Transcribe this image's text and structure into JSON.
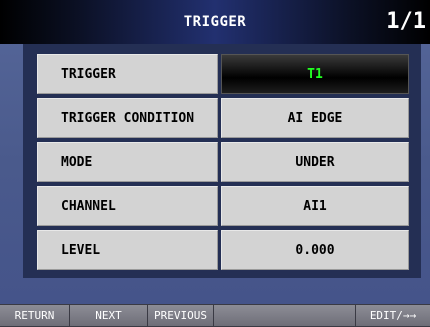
{
  "header": {
    "title": "TRIGGER",
    "page": "1/1"
  },
  "settings": [
    {
      "label": "TRIGGER",
      "value": "T1"
    },
    {
      "label": "TRIGGER CONDITION",
      "value": "AI EDGE"
    },
    {
      "label": "MODE",
      "value": "UNDER"
    },
    {
      "label": "CHANNEL",
      "value": "AI1"
    },
    {
      "label": "LEVEL",
      "value": "0.000"
    }
  ],
  "softkeys": [
    "RETURN",
    "NEXT",
    "PREVIOUS",
    "",
    "EDIT/→→"
  ],
  "colors": {
    "background": "#4a5a8c",
    "panel": "#242f54",
    "cell": "#d3d3d3",
    "active_value_text": "#22ff22",
    "softkey": "#7a7a84"
  }
}
